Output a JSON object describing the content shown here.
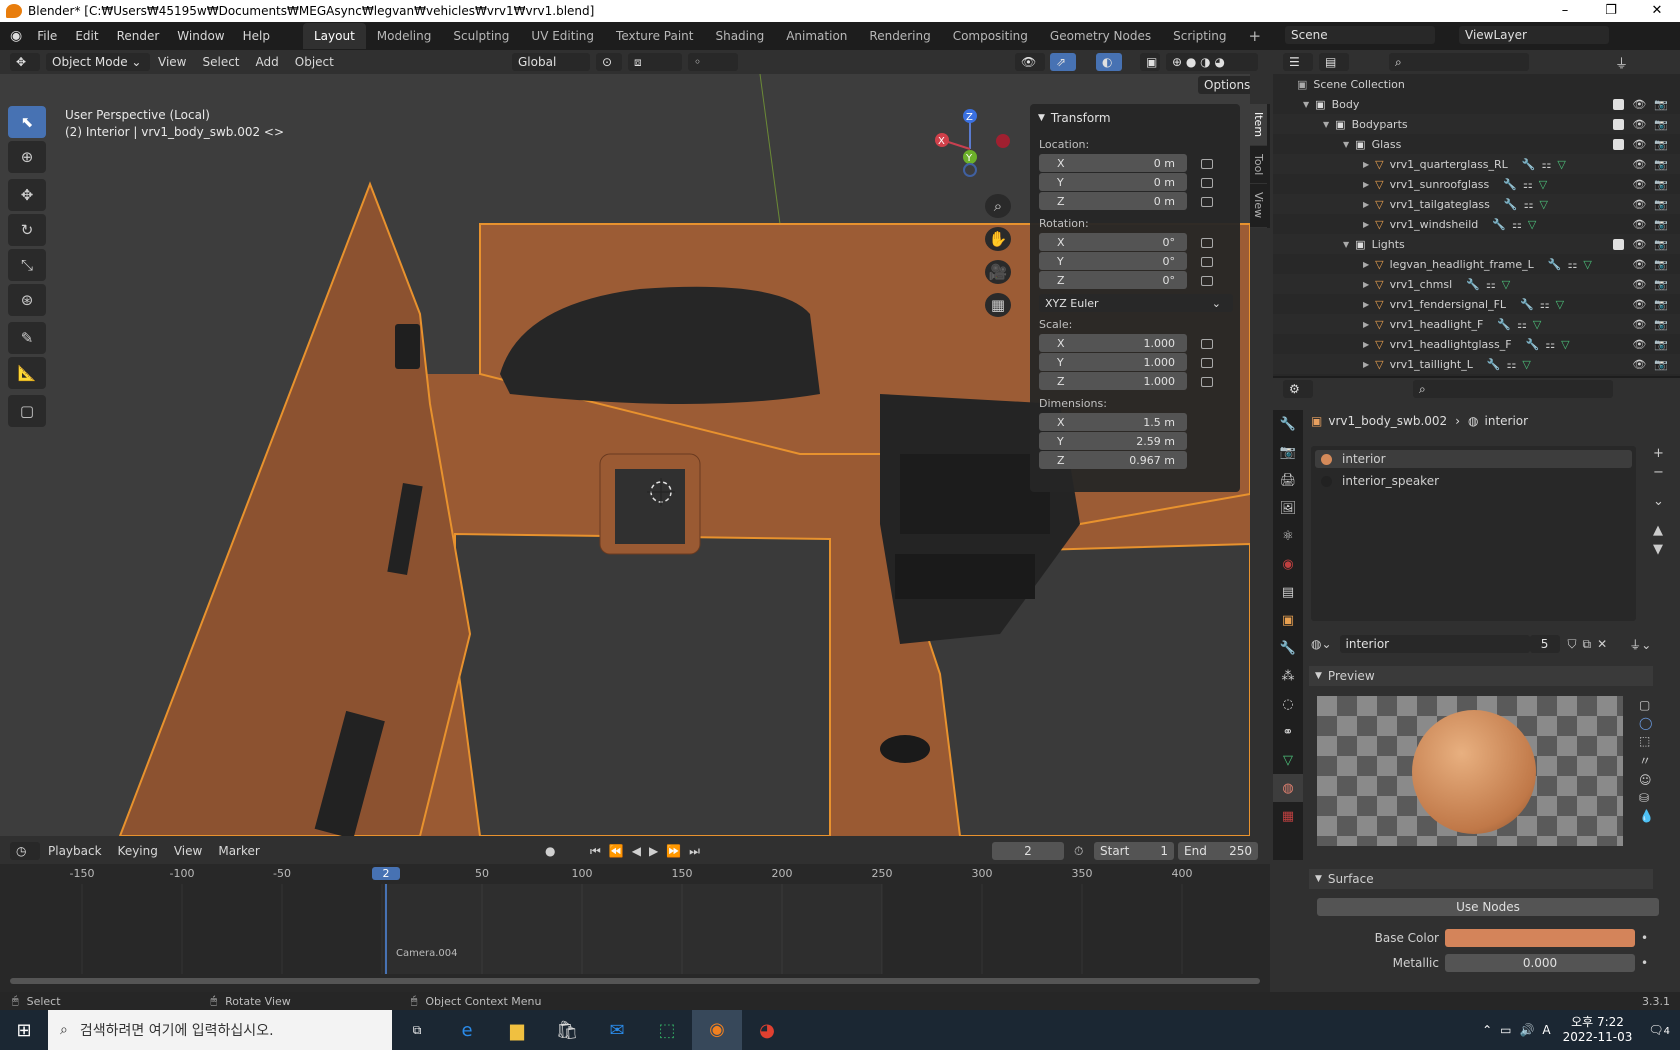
{
  "window": {
    "title": "Blender* [C:₩Users₩45195w₩Documents₩MEGAsync₩legvan₩vehicles₩vrv1₩vrv1.blend]"
  },
  "menu": [
    "File",
    "Edit",
    "Render",
    "Window",
    "Help"
  ],
  "workspaces": [
    "Layout",
    "Modeling",
    "Sculpting",
    "UV Editing",
    "Texture Paint",
    "Shading",
    "Animation",
    "Rendering",
    "Compositing",
    "Geometry Nodes",
    "Scripting"
  ],
  "scene": {
    "name": "Scene",
    "view_layer": "ViewLayer"
  },
  "viewport": {
    "mode": "Object Mode",
    "menus": [
      "View",
      "Select",
      "Add",
      "Object"
    ],
    "orientation": "Global",
    "options": "Options",
    "info_line1": "User Perspective (Local)",
    "info_line2": "(2) Interior | vrv1_body_swb.002 <>"
  },
  "npanel": {
    "title": "Transform",
    "location_label": "Location:",
    "rotation_label": "Rotation:",
    "scale_label": "Scale:",
    "dimensions_label": "Dimensions:",
    "rot_mode": "XYZ Euler",
    "location": [
      [
        "X",
        "0 m"
      ],
      [
        "Y",
        "0 m"
      ],
      [
        "Z",
        "0 m"
      ]
    ],
    "rotation": [
      [
        "X",
        "0°"
      ],
      [
        "Y",
        "0°"
      ],
      [
        "Z",
        "0°"
      ]
    ],
    "scale": [
      [
        "X",
        "1.000"
      ],
      [
        "Y",
        "1.000"
      ],
      [
        "Z",
        "1.000"
      ]
    ],
    "dimensions": [
      [
        "X",
        "1.5 m"
      ],
      [
        "Y",
        "2.59 m"
      ],
      [
        "Z",
        "0.967 m"
      ]
    ],
    "tabs": [
      "Item",
      "Tool",
      "View"
    ]
  },
  "outliner": {
    "root": "Scene Collection",
    "rows": [
      {
        "name": "Body",
        "indent": 1,
        "type": "coll"
      },
      {
        "name": "Bodyparts",
        "indent": 2,
        "type": "coll"
      },
      {
        "name": "Glass",
        "indent": 3,
        "type": "coll"
      },
      {
        "name": "vrv1_quarterglass_RL",
        "indent": 4,
        "type": "obj"
      },
      {
        "name": "vrv1_sunroofglass",
        "indent": 4,
        "type": "obj"
      },
      {
        "name": "vrv1_tailgateglass",
        "indent": 4,
        "type": "obj"
      },
      {
        "name": "vrv1_windsheild",
        "indent": 4,
        "type": "obj"
      },
      {
        "name": "Lights",
        "indent": 3,
        "type": "coll"
      },
      {
        "name": "legvan_headlight_frame_L",
        "indent": 4,
        "type": "obj"
      },
      {
        "name": "vrv1_chmsl",
        "indent": 4,
        "type": "obj"
      },
      {
        "name": "vrv1_fendersignal_FL",
        "indent": 4,
        "type": "obj"
      },
      {
        "name": "vrv1_headlight_F",
        "indent": 4,
        "type": "obj"
      },
      {
        "name": "vrv1_headlightglass_F",
        "indent": 4,
        "type": "obj"
      },
      {
        "name": "vrv1_taillight_L",
        "indent": 4,
        "type": "obj"
      }
    ]
  },
  "properties": {
    "object": "vrv1_body_swb.002",
    "material": "interior",
    "slots": [
      "interior",
      "interior_speaker"
    ],
    "users": "5",
    "preview": "Preview",
    "surface": "Surface",
    "use_nodes": "Use Nodes",
    "base_color_label": "Base Color",
    "base_color": "#d4845a",
    "metallic_label": "Metallic",
    "metallic": "0.000"
  },
  "timeline": {
    "menus": [
      "Playback",
      "Keying",
      "View",
      "Marker"
    ],
    "current_frame": "2",
    "start_label": "Start",
    "start": "1",
    "end_label": "End",
    "end": "250",
    "ticks": [
      "-150",
      "-100",
      "-50",
      "2",
      "50",
      "100",
      "150",
      "200",
      "250",
      "300",
      "350",
      "400"
    ],
    "marker": "Camera.004"
  },
  "status": {
    "left": "Select",
    "mid": "Rotate View",
    "right": "Object Context Menu",
    "version": "3.3.1"
  },
  "taskbar": {
    "search": "검색하려면 여기에 입력하십시오.",
    "time": "오후 7:22",
    "date": "2022-11-03",
    "notif": "4",
    "ime": "A"
  }
}
